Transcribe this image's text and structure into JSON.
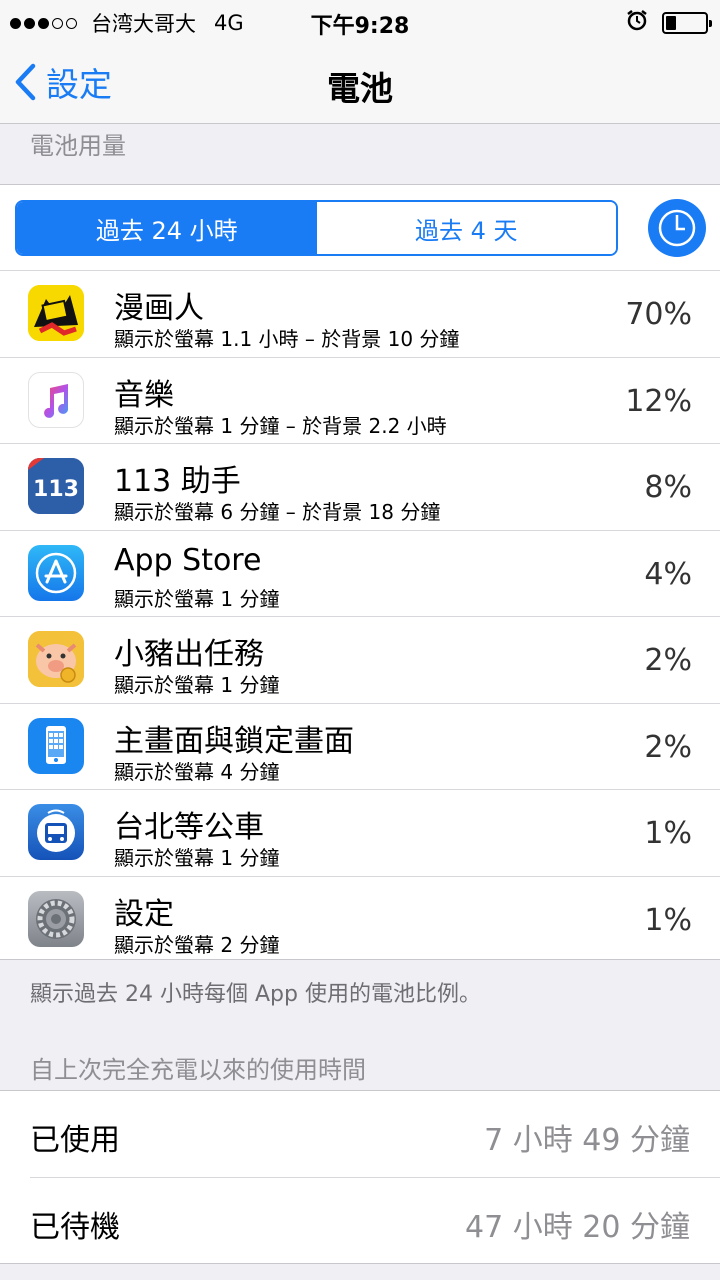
{
  "status_bar": {
    "carrier": "台湾大哥大",
    "network": "4G",
    "time": "下午9:28",
    "signal_dots": 3,
    "battery_level_fraction": 0.2
  },
  "nav": {
    "back_label": "設定",
    "title": "電池"
  },
  "section_usage_header": "電池用量",
  "segment": {
    "options": [
      "過去 24 小時",
      "過去 4 天"
    ],
    "selected": 0
  },
  "apps": [
    {
      "name": "漫画人",
      "detail": "顯示於螢幕 1.1 小時 – 於背景 10 分鐘",
      "percent": "70%",
      "icon": "manhuaren-icon"
    },
    {
      "name": "音樂",
      "detail": "顯示於螢幕 1 分鐘 – 於背景 2.2 小時",
      "percent": "12%",
      "icon": "music-icon"
    },
    {
      "name": "113 助手",
      "detail": "顯示於螢幕 6 分鐘 – 於背景 18 分鐘",
      "percent": "8%",
      "icon": "113-helper-icon"
    },
    {
      "name": "App Store",
      "detail": "顯示於螢幕 1 分鐘",
      "percent": "4%",
      "icon": "app-store-icon"
    },
    {
      "name": "小豬出任務",
      "detail": "顯示於螢幕 1 分鐘",
      "percent": "2%",
      "icon": "piggy-icon"
    },
    {
      "name": "主畫面與鎖定畫面",
      "detail": "顯示於螢幕 4 分鐘",
      "percent": "2%",
      "icon": "home-lock-screen-icon"
    },
    {
      "name": "台北等公車",
      "detail": "顯示於螢幕 1 分鐘",
      "percent": "1%",
      "icon": "bus-icon"
    },
    {
      "name": "設定",
      "detail": "顯示於螢幕 2 分鐘",
      "percent": "1%",
      "icon": "settings-gear-icon"
    }
  ],
  "footer_note": "顯示過去 24 小時每個 App 使用的電池比例。",
  "usage_since_charge_header": "自上次完全充電以來的使用時間",
  "usage": {
    "used_label": "已使用",
    "used_value": "7 小時 49 分鐘",
    "standby_label": "已待機",
    "standby_value": "47 小時 20 分鐘"
  },
  "colors": {
    "accent": "#1a7cf5",
    "background": "#efeff4",
    "secondary_text": "#8e8e93"
  }
}
